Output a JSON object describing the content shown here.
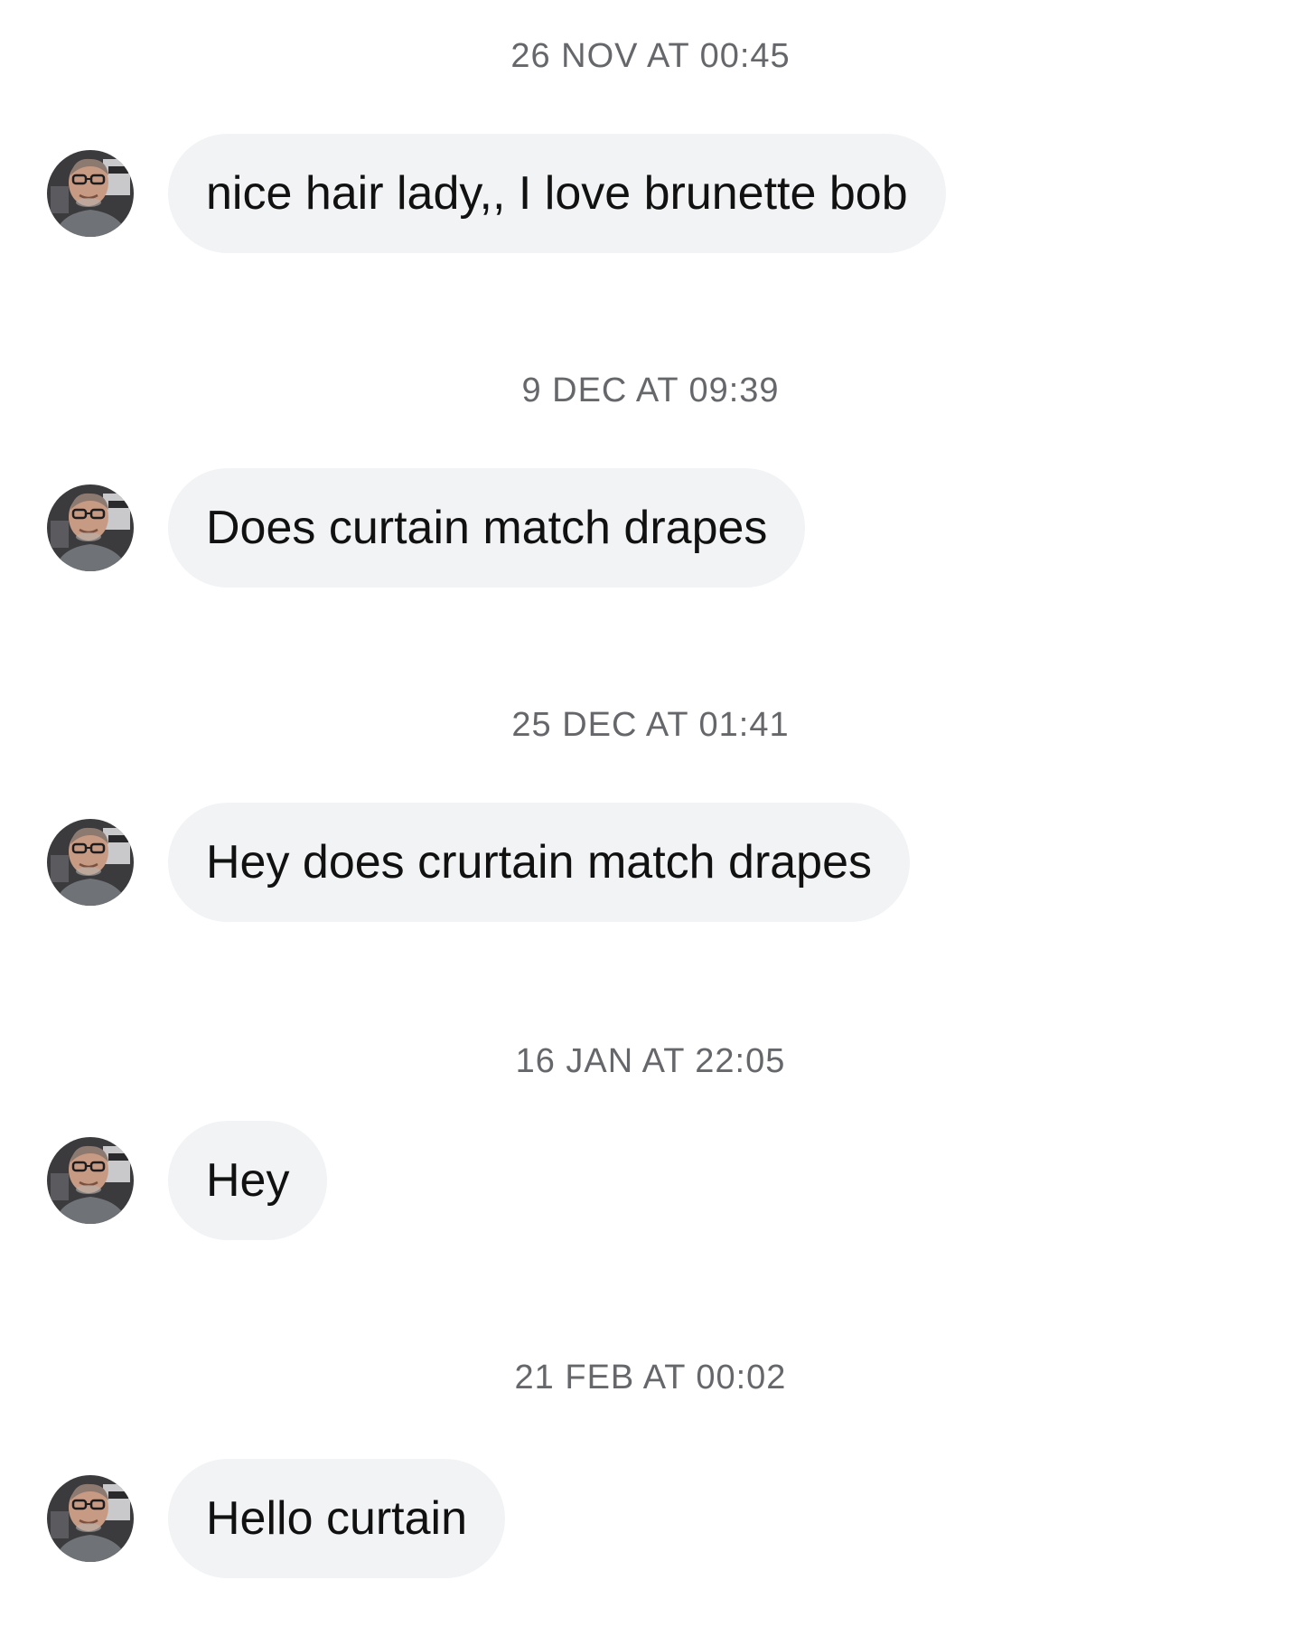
{
  "thread": {
    "groups": [
      {
        "timestamp": "26 NOV AT 00:45",
        "message": "nice hair lady,, I love brunette bob",
        "avatar_icon": "sender-avatar"
      },
      {
        "timestamp": "9 DEC AT 09:39",
        "message": "Does curtain match drapes",
        "avatar_icon": "sender-avatar"
      },
      {
        "timestamp": "25 DEC AT 01:41",
        "message": "Hey does crurtain match drapes",
        "avatar_icon": "sender-avatar"
      },
      {
        "timestamp": "16 JAN AT 22:05",
        "message": "Hey",
        "avatar_icon": "sender-avatar"
      },
      {
        "timestamp": "21 FEB AT 00:02",
        "message": "Hello curtain",
        "avatar_icon": "sender-avatar"
      }
    ]
  },
  "colors": {
    "background": "#ffffff",
    "bubble": "#f1f3f4",
    "timestamp_text": "#65676b",
    "message_text": "#111111"
  }
}
